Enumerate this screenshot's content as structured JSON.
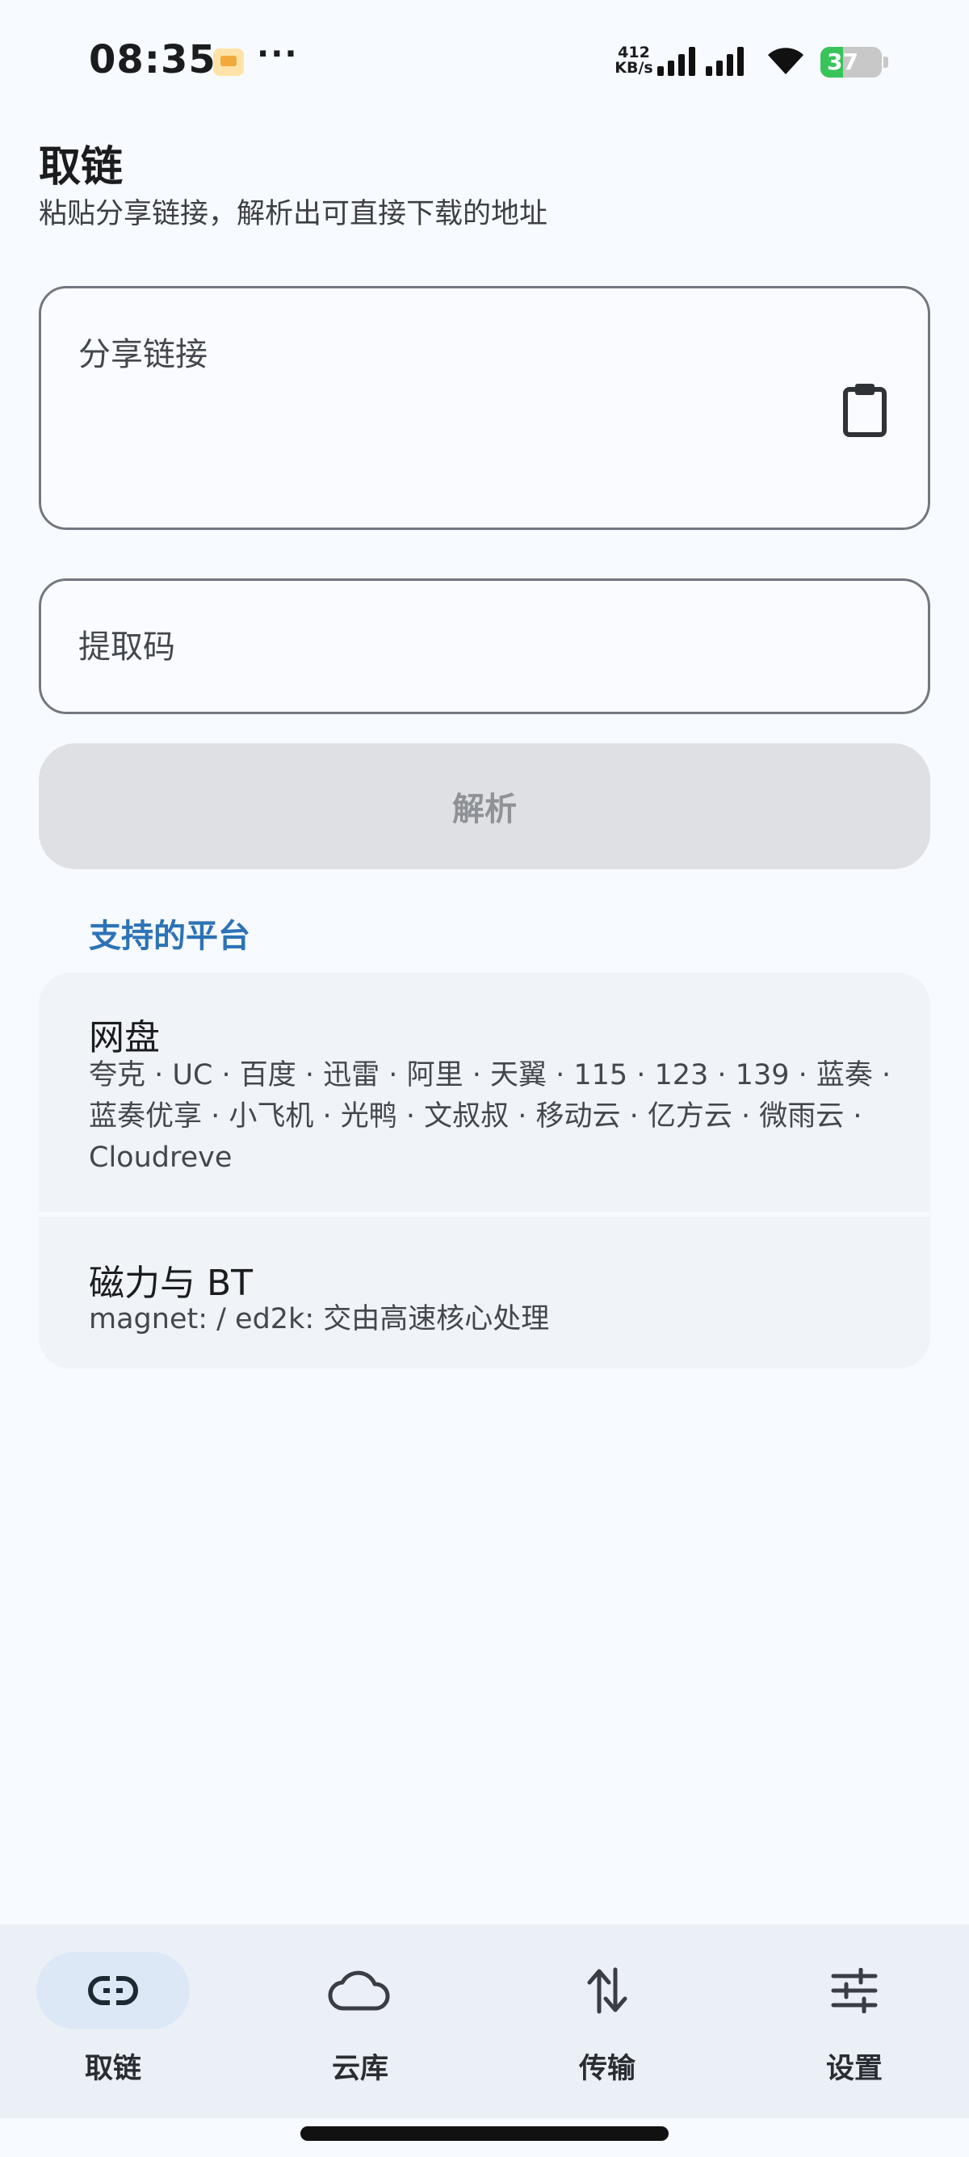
{
  "status_bar": {
    "time": "08:35",
    "more": "···",
    "speed_value": "412",
    "speed_unit": "KB/s",
    "battery": "37"
  },
  "header": {
    "title": "取链",
    "subtitle": "粘贴分享链接，解析出可直接下载的地址"
  },
  "form": {
    "link_placeholder": "分享链接",
    "code_placeholder": "提取码",
    "parse_label": "解析"
  },
  "platforms": {
    "section_title": "支持的平台",
    "items": [
      {
        "title": "网盘",
        "desc": "夸克 · UC · 百度 · 迅雷 · 阿里 · 天翼 · 115 · 123 · 139 · 蓝奏 · 蓝奏优享 · 小飞机 · 光鸭 · 文叔叔 · 移动云 · 亿方云 · 微雨云 · Cloudreve"
      },
      {
        "title": "磁力与 BT",
        "desc": "magnet: / ed2k: 交由高速核心处理"
      }
    ]
  },
  "nav": {
    "items": [
      {
        "label": "取链",
        "icon": "link-icon",
        "active": true
      },
      {
        "label": "云库",
        "icon": "cloud-icon",
        "active": false
      },
      {
        "label": "传输",
        "icon": "transfer-icon",
        "active": false
      },
      {
        "label": "设置",
        "icon": "sliders-icon",
        "active": false
      }
    ]
  },
  "colors": {
    "background": "#F7FAFE",
    "accent": "#2D73B6",
    "battery_green": "#39C35B",
    "nav_active_pill": "#DCE8F6"
  }
}
